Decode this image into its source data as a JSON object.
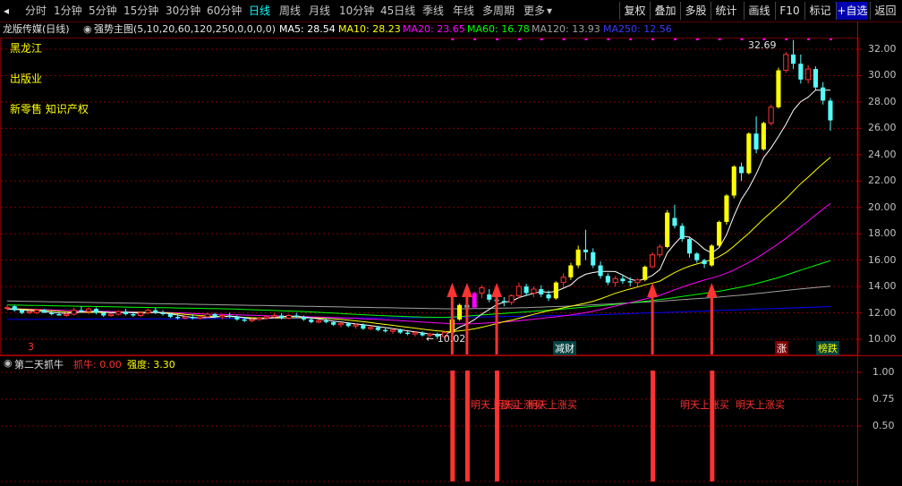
{
  "toolbar": {
    "left_expand": "◂",
    "periods": [
      "分时",
      "1分钟",
      "5分钟",
      "15分钟",
      "30分钟",
      "60分钟",
      "日线",
      "周线",
      "月线",
      "10分钟",
      "45日线",
      "季线",
      "年线",
      "多周期",
      "更多"
    ],
    "active_period": "日线",
    "more_arrow": "▾",
    "buttons": [
      "复权",
      "叠加",
      "多股",
      "统计",
      "画线",
      "F10",
      "标记",
      "+自选",
      "返回"
    ]
  },
  "chart_title": {
    "stock": "龙版传媒(日线)",
    "indicator": "强势主图(5,10,20,60,120,250,0,0,0,0)",
    "ma5": "MA5: 28.54",
    "ma10": "MA10: 28.23",
    "ma20": "MA20: 23.65",
    "ma60": "MA60: 16.78",
    "ma120": "MA120: 13.93",
    "ma250": "MA250: 12.56"
  },
  "concepts": [
    "黑龙江",
    "出版业",
    "新零售 知识产权"
  ],
  "price_axis": [
    "32.00",
    "30.00",
    "28.00",
    "26.00",
    "24.00",
    "22.00",
    "20.00",
    "18.00",
    "16.00",
    "14.00",
    "12.00",
    "10.00"
  ],
  "annotations": {
    "high": "32.69",
    "low": "← 10.02",
    "tag_jiancai": "减财",
    "tag_zhang": "涨",
    "tag_bangdie": "榜跌",
    "tag_left": "3"
  },
  "sub_panel": {
    "name": "第二天抓牛",
    "zhuaniu": "抓牛: 0.00",
    "qiangdu": "强度: 3.30",
    "axis": [
      "1.00",
      "0.75",
      "0.50"
    ],
    "signals": [
      "明天上涨买",
      "明天上涨买",
      "明天上涨买",
      "明天上涨买",
      "明天上涨买"
    ]
  },
  "colors": {
    "up": "#ff3232",
    "down": "#54fcfc",
    "yellow": "#ffff00",
    "magenta": "#ff00ff",
    "ma5": "#ffffff",
    "ma20": "#ff00ff",
    "ma60": "#00ff00",
    "ma120": "#a0a0a0",
    "ma250": "#0000ff",
    "grid": "#800000",
    "active": "#00ffff"
  },
  "chart_data": {
    "type": "candlestick",
    "ylim": [
      9.0,
      33.0
    ],
    "candles": [
      [
        12.4,
        12.6,
        12.2,
        12.4
      ],
      [
        12.5,
        12.6,
        12.1,
        12.2
      ],
      [
        12.2,
        12.3,
        11.9,
        12.0
      ],
      [
        12.0,
        12.2,
        11.9,
        12.1
      ],
      [
        12.0,
        12.3,
        11.9,
        12.2
      ],
      [
        12.2,
        12.3,
        12.0,
        12.0
      ],
      [
        12.0,
        12.2,
        11.8,
        11.9
      ],
      [
        11.9,
        12.1,
        11.8,
        11.8
      ],
      [
        11.8,
        12.0,
        11.7,
        11.9
      ],
      [
        11.9,
        12.4,
        11.8,
        12.2
      ],
      [
        12.2,
        12.5,
        12.0,
        12.1
      ],
      [
        12.1,
        12.4,
        11.9,
        12.3
      ],
      [
        12.3,
        12.4,
        11.9,
        12.0
      ],
      [
        12.0,
        12.1,
        11.7,
        11.8
      ],
      [
        11.8,
        12.0,
        11.7,
        11.9
      ],
      [
        11.9,
        12.2,
        11.8,
        12.1
      ],
      [
        12.1,
        12.3,
        11.8,
        11.9
      ],
      [
        11.9,
        12.1,
        11.7,
        11.8
      ],
      [
        11.8,
        12.1,
        11.7,
        12.0
      ],
      [
        12.0,
        12.3,
        11.9,
        12.2
      ],
      [
        12.2,
        12.4,
        11.9,
        12.0
      ],
      [
        12.0,
        12.2,
        11.8,
        11.9
      ],
      [
        11.9,
        12.0,
        11.6,
        11.7
      ],
      [
        11.7,
        11.9,
        11.5,
        11.6
      ],
      [
        11.6,
        11.8,
        11.5,
        11.7
      ],
      [
        11.7,
        11.9,
        11.5,
        11.6
      ],
      [
        11.6,
        11.8,
        11.5,
        11.7
      ],
      [
        11.7,
        12.0,
        11.6,
        11.9
      ],
      [
        11.9,
        12.0,
        11.6,
        11.7
      ],
      [
        11.7,
        11.9,
        11.5,
        11.8
      ],
      [
        11.8,
        12.0,
        11.6,
        11.7
      ],
      [
        11.7,
        11.8,
        11.4,
        11.5
      ],
      [
        11.5,
        11.7,
        11.3,
        11.4
      ],
      [
        11.4,
        11.6,
        11.3,
        11.5
      ],
      [
        11.5,
        11.7,
        11.4,
        11.6
      ],
      [
        11.6,
        11.8,
        11.5,
        11.7
      ],
      [
        11.7,
        12.0,
        11.6,
        11.8
      ],
      [
        11.8,
        12.0,
        11.5,
        11.6
      ],
      [
        11.6,
        11.9,
        11.5,
        11.8
      ],
      [
        11.8,
        12.0,
        11.6,
        11.7
      ],
      [
        11.7,
        11.8,
        11.4,
        11.5
      ],
      [
        11.5,
        11.6,
        11.2,
        11.3
      ],
      [
        11.3,
        11.5,
        11.2,
        11.4
      ],
      [
        11.4,
        11.6,
        11.2,
        11.3
      ],
      [
        11.3,
        11.4,
        11.0,
        11.1
      ],
      [
        11.1,
        11.3,
        10.9,
        11.2
      ],
      [
        11.2,
        11.3,
        10.9,
        11.0
      ],
      [
        11.0,
        11.2,
        10.8,
        11.1
      ],
      [
        11.1,
        11.2,
        10.7,
        10.8
      ],
      [
        10.8,
        11.0,
        10.7,
        10.9
      ],
      [
        10.9,
        11.0,
        10.6,
        10.7
      ],
      [
        10.7,
        10.9,
        10.5,
        10.6
      ],
      [
        10.6,
        10.8,
        10.4,
        10.7
      ],
      [
        10.7,
        10.8,
        10.4,
        10.5
      ],
      [
        10.5,
        10.7,
        10.3,
        10.4
      ],
      [
        10.4,
        10.6,
        10.2,
        10.5
      ],
      [
        10.5,
        10.6,
        10.2,
        10.3
      ],
      [
        10.3,
        10.5,
        10.1,
        10.4
      ],
      [
        10.4,
        10.5,
        10.02,
        10.2
      ],
      [
        10.2,
        10.6,
        10.1,
        10.5
      ],
      [
        10.5,
        11.6,
        10.4,
        11.5
      ],
      [
        11.5,
        12.7,
        11.4,
        12.6
      ],
      [
        12.6,
        13.1,
        12.2,
        12.4
      ],
      [
        12.4,
        13.6,
        12.3,
        13.5
      ],
      [
        13.5,
        14.1,
        13.1,
        13.9
      ],
      [
        13.4,
        13.8,
        12.8,
        13.0
      ],
      [
        13.0,
        13.4,
        12.6,
        12.9
      ],
      [
        12.9,
        13.2,
        12.5,
        12.8
      ],
      [
        12.8,
        13.4,
        12.6,
        13.3
      ],
      [
        13.3,
        14.3,
        13.1,
        14.0
      ],
      [
        14.0,
        14.2,
        13.3,
        13.5
      ],
      [
        13.5,
        14.0,
        13.2,
        13.8
      ],
      [
        13.8,
        14.1,
        13.2,
        13.4
      ],
      [
        13.4,
        13.7,
        12.9,
        13.1
      ],
      [
        13.1,
        14.4,
        13.0,
        14.3
      ],
      [
        14.3,
        15.0,
        13.9,
        14.7
      ],
      [
        14.7,
        15.8,
        14.5,
        15.6
      ],
      [
        15.6,
        17.1,
        15.4,
        16.8
      ],
      [
        16.8,
        18.3,
        16.0,
        16.6
      ],
      [
        16.6,
        16.9,
        15.4,
        15.6
      ],
      [
        15.6,
        15.9,
        14.6,
        14.8
      ],
      [
        14.8,
        15.0,
        14.1,
        14.3
      ],
      [
        14.3,
        14.8,
        14.0,
        14.6
      ],
      [
        14.6,
        14.9,
        14.2,
        14.4
      ],
      [
        14.4,
        14.7,
        14.0,
        14.3
      ],
      [
        14.3,
        14.6,
        14.0,
        14.5
      ],
      [
        14.5,
        15.6,
        14.4,
        15.5
      ],
      [
        15.5,
        16.6,
        15.4,
        16.4
      ],
      [
        16.4,
        17.2,
        16.2,
        17.0
      ],
      [
        17.0,
        19.8,
        16.9,
        19.6
      ],
      [
        19.2,
        20.2,
        18.4,
        18.6
      ],
      [
        18.6,
        18.8,
        17.4,
        17.6
      ],
      [
        17.6,
        17.8,
        16.2,
        16.5
      ],
      [
        16.5,
        16.6,
        15.8,
        16.0
      ],
      [
        16.0,
        16.1,
        15.4,
        15.7
      ],
      [
        15.6,
        17.2,
        15.5,
        17.1
      ],
      [
        17.1,
        19.0,
        17.0,
        18.9
      ],
      [
        18.9,
        21.0,
        18.7,
        20.9
      ],
      [
        20.9,
        23.2,
        20.7,
        23.1
      ],
      [
        23.1,
        23.4,
        22.0,
        22.6
      ],
      [
        22.6,
        25.7,
        22.5,
        25.6
      ],
      [
        25.6,
        26.9,
        24.1,
        24.4
      ],
      [
        24.4,
        26.5,
        24.3,
        26.4
      ],
      [
        26.4,
        27.8,
        26.2,
        27.6
      ],
      [
        27.6,
        30.6,
        27.5,
        30.4
      ],
      [
        30.4,
        31.8,
        30.2,
        31.6
      ],
      [
        31.6,
        32.69,
        30.5,
        30.9
      ],
      [
        30.9,
        31.6,
        29.4,
        29.7
      ],
      [
        29.7,
        30.8,
        29.4,
        30.5
      ],
      [
        30.5,
        30.7,
        28.9,
        29.1
      ],
      [
        29.1,
        29.5,
        27.8,
        28.1
      ],
      [
        28.1,
        28.3,
        25.8,
        26.6
      ]
    ],
    "ma5": [
      12.3,
      12.27,
      12.23,
      12.17,
      12.13,
      12.11,
      12.03,
      11.99,
      11.97,
      12.0,
      12.05,
      12.09,
      12.12,
      12.07,
      12.01,
      12.03,
      12.04,
      12.0,
      11.97,
      12.0,
      12.03,
      12.0,
      11.93,
      11.83,
      11.74,
      11.65,
      11.63,
      11.65,
      11.67,
      11.75,
      11.75,
      11.72,
      11.62,
      11.54,
      11.54,
      11.58,
      11.64,
      11.71,
      11.75,
      11.74,
      11.68,
      11.62,
      11.55,
      11.45,
      11.37,
      11.32,
      11.24,
      11.16,
      11.1,
      11.04,
      10.96,
      10.88,
      10.81,
      10.72,
      10.64,
      10.56,
      10.48,
      10.4,
      10.36,
      10.38,
      10.58,
      10.92,
      11.15,
      11.49,
      11.91,
      12.26,
      12.62,
      12.81,
      12.88,
      13.16,
      13.33,
      13.48,
      13.62,
      13.56,
      13.63,
      13.87,
      14.12,
      14.63,
      14.93,
      15.06,
      15.14,
      15.14,
      15.13,
      14.87,
      14.55,
      14.42,
      14.58,
      14.84,
      15.28,
      16.54,
      17.23,
      17.82,
      17.74,
      17.34,
      16.84,
      16.54,
      16.95,
      17.93,
      19.37,
      20.61,
      21.47,
      22.54,
      23.79,
      24.51,
      25.38,
      26.3,
      27.36,
      28.02,
      28.36,
      28.9,
      28.9,
      28.89
    ],
    "ma10": [
      12.3,
      12.3,
      12.28,
      12.25,
      12.22,
      12.2,
      12.15,
      12.11,
      12.07,
      12.05,
      12.05,
      12.04,
      12.04,
      12.04,
      12.03,
      12.04,
      12.04,
      12.04,
      12.04,
      12.04,
      12.04,
      12.02,
      11.98,
      11.94,
      11.88,
      11.84,
      11.8,
      11.76,
      11.73,
      11.72,
      11.71,
      11.7,
      11.66,
      11.63,
      11.61,
      11.61,
      11.61,
      11.61,
      11.63,
      11.63,
      11.63,
      11.62,
      11.61,
      11.58,
      11.54,
      11.5,
      11.45,
      11.39,
      11.33,
      11.26,
      11.19,
      11.12,
      11.05,
      10.98,
      10.91,
      10.84,
      10.77,
      10.7,
      10.64,
      10.59,
      10.58,
      10.64,
      10.7,
      10.79,
      10.91,
      11.04,
      11.19,
      11.33,
      11.44,
      11.59,
      11.74,
      11.89,
      12.03,
      12.16,
      12.27,
      12.38,
      12.5,
      12.62,
      12.74,
      12.88,
      13.06,
      13.27,
      13.48,
      13.65,
      13.81,
      13.96,
      14.12,
      14.26,
      14.41,
      14.74,
      15.05,
      15.32,
      15.54,
      15.71,
      15.87,
      16.03,
      16.27,
      16.61,
      17.06,
      17.56,
      18.04,
      18.58,
      19.13,
      19.63,
      20.14,
      20.66,
      21.24,
      21.8,
      22.29,
      22.82,
      23.32,
      23.8
    ],
    "ma20": [
      12.3,
      12.3,
      12.29,
      12.28,
      12.26,
      12.24,
      12.22,
      12.2,
      12.18,
      12.16,
      12.14,
      12.13,
      12.12,
      12.11,
      12.1,
      12.09,
      12.08,
      12.07,
      12.06,
      12.06,
      12.05,
      12.04,
      12.02,
      12.0,
      11.98,
      11.95,
      11.93,
      11.91,
      11.89,
      11.88,
      11.86,
      11.85,
      11.83,
      11.81,
      11.8,
      11.78,
      11.77,
      11.75,
      11.74,
      11.72,
      11.71,
      11.69,
      11.68,
      11.66,
      11.64,
      11.62,
      11.6,
      11.58,
      11.55,
      11.53,
      11.5,
      11.47,
      11.44,
      11.41,
      11.37,
      11.34,
      11.3,
      11.27,
      11.23,
      11.2,
      11.17,
      11.17,
      11.17,
      11.18,
      11.21,
      11.24,
      11.27,
      11.31,
      11.35,
      11.4,
      11.46,
      11.52,
      11.58,
      11.64,
      11.7,
      11.77,
      11.84,
      11.93,
      12.02,
      12.13,
      12.25,
      12.38,
      12.51,
      12.65,
      12.78,
      12.91,
      13.05,
      13.19,
      13.33,
      13.54,
      13.75,
      13.95,
      14.14,
      14.32,
      14.49,
      14.64,
      14.81,
      15.01,
      15.25,
      15.53,
      15.82,
      16.15,
      16.5,
      16.87,
      17.25,
      17.65,
      18.08,
      18.53,
      18.96,
      19.42,
      19.87,
      20.3
    ],
    "ma60": [
      12.6,
      12.59,
      12.58,
      12.57,
      12.56,
      12.55,
      12.54,
      12.53,
      12.52,
      12.51,
      12.5,
      12.49,
      12.48,
      12.47,
      12.46,
      12.45,
      12.44,
      12.43,
      12.42,
      12.41,
      12.4,
      12.39,
      12.38,
      12.37,
      12.36,
      12.35,
      12.34,
      12.33,
      12.32,
      12.31,
      12.3,
      12.28,
      12.26,
      12.24,
      12.22,
      12.2,
      12.18,
      12.16,
      12.14,
      12.12,
      12.1,
      12.07,
      12.04,
      12.01,
      11.98,
      11.95,
      11.92,
      11.89,
      11.86,
      11.83,
      11.8,
      11.78,
      11.76,
      11.74,
      11.72,
      11.7,
      11.68,
      11.67,
      11.66,
      11.66,
      11.68,
      11.72,
      11.76,
      11.8,
      11.84,
      11.88,
      11.92,
      11.96,
      12.0,
      12.04,
      12.08,
      12.12,
      12.16,
      12.2,
      12.24,
      12.29,
      12.34,
      12.39,
      12.44,
      12.49,
      12.54,
      12.59,
      12.64,
      12.7,
      12.76,
      12.82,
      12.88,
      12.94,
      13.0,
      13.08,
      13.16,
      13.24,
      13.32,
      13.4,
      13.48,
      13.56,
      13.64,
      13.74,
      13.85,
      13.96,
      14.08,
      14.22,
      14.37,
      14.52,
      14.68,
      14.86,
      15.05,
      15.24,
      15.42,
      15.6,
      15.78,
      15.96
    ],
    "ma120": [
      12.9,
      12.89,
      12.88,
      12.87,
      12.86,
      12.85,
      12.84,
      12.83,
      12.82,
      12.81,
      12.8,
      12.79,
      12.78,
      12.77,
      12.76,
      12.75,
      12.74,
      12.73,
      12.72,
      12.71,
      12.7,
      12.69,
      12.68,
      12.67,
      12.66,
      12.65,
      12.64,
      12.63,
      12.62,
      12.61,
      12.6,
      12.59,
      12.58,
      12.57,
      12.56,
      12.55,
      12.54,
      12.53,
      12.52,
      12.51,
      12.5,
      12.49,
      12.48,
      12.47,
      12.46,
      12.45,
      12.44,
      12.43,
      12.42,
      12.41,
      12.4,
      12.39,
      12.38,
      12.37,
      12.36,
      12.35,
      12.34,
      12.33,
      12.32,
      12.31,
      12.31,
      12.31,
      12.31,
      12.32,
      12.33,
      12.34,
      12.35,
      12.36,
      12.37,
      12.38,
      12.4,
      12.42,
      12.44,
      12.46,
      12.48,
      12.5,
      12.52,
      12.55,
      12.58,
      12.61,
      12.64,
      12.67,
      12.7,
      12.73,
      12.76,
      12.79,
      12.82,
      12.85,
      12.88,
      12.92,
      12.96,
      13.0,
      13.04,
      13.08,
      13.12,
      13.16,
      13.2,
      13.25,
      13.3,
      13.35,
      13.4,
      13.46,
      13.52,
      13.58,
      13.64,
      13.7,
      13.76,
      13.82,
      13.87,
      13.92,
      13.97,
      14.02
    ],
    "ma250": [
      11.5,
      11.5,
      11.5,
      11.5,
      11.51,
      11.51,
      11.51,
      11.51,
      11.52,
      11.52,
      11.52,
      11.52,
      11.53,
      11.53,
      11.53,
      11.53,
      11.54,
      11.54,
      11.54,
      11.54,
      11.55,
      11.55,
      11.55,
      11.55,
      11.56,
      11.56,
      11.56,
      11.56,
      11.57,
      11.57,
      11.57,
      11.57,
      11.58,
      11.58,
      11.58,
      11.58,
      11.59,
      11.59,
      11.59,
      11.59,
      11.6,
      11.6,
      11.6,
      11.6,
      11.61,
      11.61,
      11.61,
      11.61,
      11.62,
      11.62,
      11.62,
      11.62,
      11.63,
      11.63,
      11.63,
      11.63,
      11.64,
      11.64,
      11.64,
      11.64,
      11.65,
      11.66,
      11.67,
      11.68,
      11.69,
      11.7,
      11.71,
      11.72,
      11.73,
      11.74,
      11.75,
      11.76,
      11.77,
      11.78,
      11.79,
      11.8,
      11.81,
      11.82,
      11.83,
      11.84,
      11.86,
      11.88,
      11.9,
      11.92,
      11.94,
      11.96,
      11.98,
      12.0,
      12.02,
      12.04,
      12.06,
      12.08,
      12.1,
      12.12,
      12.14,
      12.16,
      12.18,
      12.2,
      12.22,
      12.24,
      12.26,
      12.28,
      12.3,
      12.32,
      12.34,
      12.36,
      12.38,
      12.4,
      12.42,
      12.44,
      12.46,
      12.48
    ],
    "signal_indices": [
      60,
      62,
      66,
      87,
      95
    ]
  }
}
